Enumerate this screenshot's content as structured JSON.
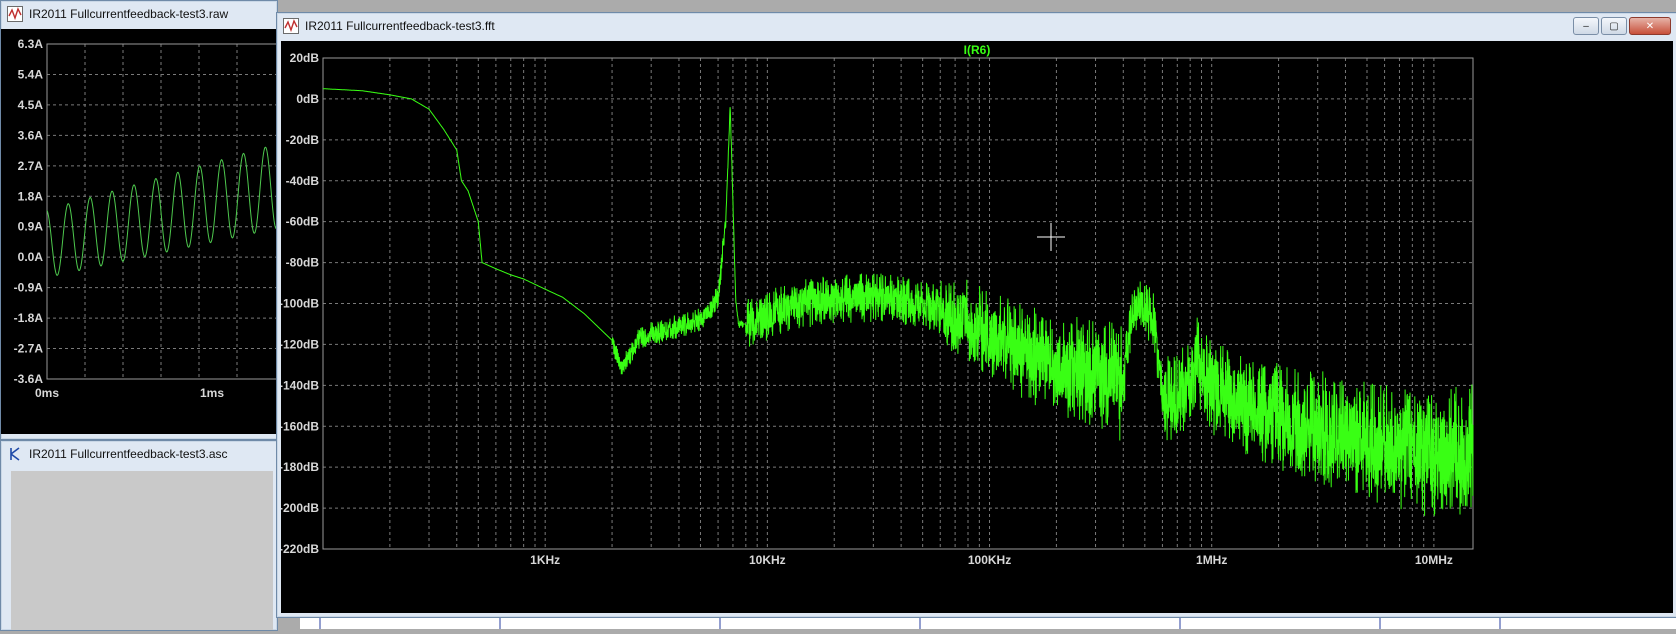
{
  "raw_window": {
    "title": "IR2011 Fullcurrentfeedback-test3.raw",
    "y_ticks": [
      "6.3A",
      "5.4A",
      "4.5A",
      "3.6A",
      "2.7A",
      "1.8A",
      "0.9A",
      "0.0A",
      "-0.9A",
      "-1.8A",
      "-2.7A",
      "-3.6A"
    ],
    "x_ticks": [
      "0ms",
      "1ms"
    ],
    "trace_color": "#4ec94e"
  },
  "asc_window": {
    "title": "IR2011 Fullcurrentfeedback-test3.asc"
  },
  "fft_window": {
    "title": "IR2011 Fullcurrentfeedback-test3.fft",
    "buttons": {
      "minimize": "‒",
      "maximize": "▢",
      "close": "✕"
    },
    "trace_label": "I(R6)",
    "trace_color": "#39ff14"
  },
  "chart_data": {
    "type": "line",
    "title": "I(R6)",
    "xscale": "log",
    "xlim": [
      100,
      15000000
    ],
    "ylim": [
      -220,
      20
    ],
    "y_ticks": [
      "20dB",
      "0dB",
      "-20dB",
      "-40dB",
      "-60dB",
      "-80dB",
      "-100dB",
      "-120dB",
      "-140dB",
      "-160dB",
      "-180dB",
      "-200dB",
      "-220dB"
    ],
    "x_ticks": [
      "1KHz",
      "10KHz",
      "100KHz",
      "1MHz",
      "10MHz"
    ],
    "grid": true,
    "series": [
      {
        "name": "I(R6)",
        "x": [
          100,
          150,
          200,
          250,
          300,
          350,
          400,
          420,
          450,
          500,
          520,
          600,
          700,
          800,
          1000,
          1200,
          1500,
          2000,
          2200,
          2400,
          2600,
          3000,
          3500,
          4000,
          5000,
          5500,
          6000,
          6500,
          6800,
          7000,
          7200,
          7400,
          8000,
          9000,
          10000,
          12000,
          15000,
          20000,
          30000,
          40000,
          60000,
          80000,
          100000,
          150000,
          200000,
          300000,
          400000,
          430000,
          460000,
          500000,
          550000,
          600000,
          700000,
          800000,
          850000,
          900000,
          1000000,
          1500000,
          2000000,
          3000000,
          5000000,
          8000000,
          10000000,
          15000000
        ],
        "y": [
          5,
          4,
          2,
          0,
          -5,
          -15,
          -25,
          -40,
          -45,
          -60,
          -80,
          -83,
          -86,
          -88,
          -93,
          -97,
          -105,
          -118,
          -132,
          -125,
          -118,
          -115,
          -113,
          -111,
          -108,
          -103,
          -97,
          -60,
          -3,
          -50,
          -97,
          -110,
          -110,
          -108,
          -106,
          -102,
          -100,
          -98,
          -97,
          -98,
          -103,
          -108,
          -115,
          -125,
          -128,
          -135,
          -140,
          -110,
          -100,
          -104,
          -108,
          -145,
          -145,
          -140,
          -128,
          -133,
          -140,
          -150,
          -155,
          -160,
          -168,
          -172,
          -175,
          -172
        ]
      }
    ]
  },
  "background": {
    "app_bg": "#ababab",
    "plot_bg": "#000000"
  }
}
